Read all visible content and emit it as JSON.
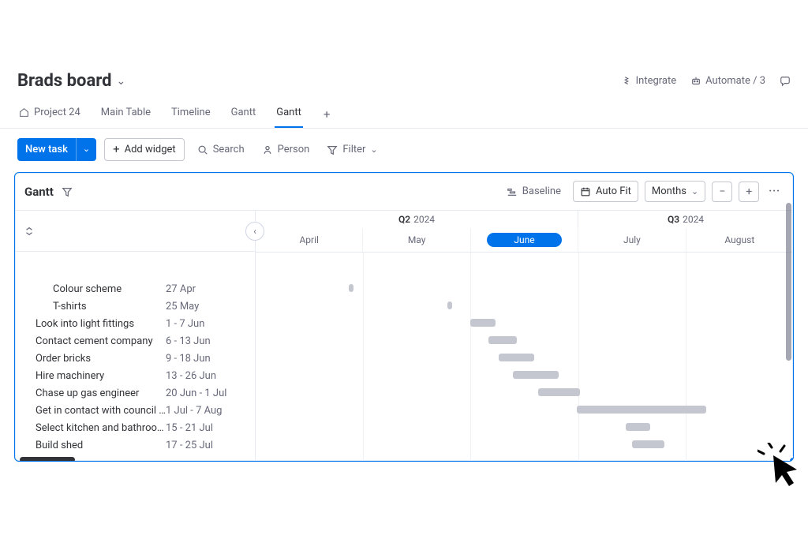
{
  "header": {
    "board_title": "Brads board",
    "integrate_label": "Integrate",
    "automate_label": "Automate / 3"
  },
  "tabs": [
    {
      "label": "Project 24",
      "icon": "home"
    },
    {
      "label": "Main Table"
    },
    {
      "label": "Timeline"
    },
    {
      "label": "Gantt"
    },
    {
      "label": "Gantt",
      "active": true
    }
  ],
  "toolbar": {
    "new_task_label": "New task",
    "add_widget_label": "Add widget",
    "search_label": "Search",
    "person_label": "Person",
    "filter_label": "Filter"
  },
  "widget": {
    "title": "Gantt",
    "baseline_label": "Baseline",
    "auto_fit_label": "Auto Fit",
    "timescale_label": "Months"
  },
  "timeline": {
    "quarters": [
      {
        "q": "Q2",
        "year": "2024"
      },
      {
        "q": "Q3",
        "year": "2024"
      }
    ],
    "months": [
      {
        "label": "April"
      },
      {
        "label": "May"
      },
      {
        "label": "June",
        "current": true
      },
      {
        "label": "July"
      },
      {
        "label": "August"
      }
    ]
  },
  "tasks": [
    {
      "name": "Colour scheme",
      "date": "27 Apr",
      "indent": true,
      "left_pct": 17.3,
      "width_pct": 0.9
    },
    {
      "name": "T-shirts",
      "date": "25 May",
      "indent": true,
      "left_pct": 35.7,
      "width_pct": 0.9
    },
    {
      "name": "Look into light fittings",
      "date": "1 - 7 Jun",
      "left_pct": 40.0,
      "width_pct": 4.6
    },
    {
      "name": "Contact cement company",
      "date": "6 - 13 Jun",
      "left_pct": 43.3,
      "width_pct": 5.3
    },
    {
      "name": "Order bricks",
      "date": "9 - 18 Jun",
      "left_pct": 45.3,
      "width_pct": 6.5
    },
    {
      "name": "Hire machinery",
      "date": "13 - 26 Jun",
      "left_pct": 47.9,
      "width_pct": 8.5
    },
    {
      "name": "Chase up gas engineer",
      "date": "20 Jun - 1 Jul",
      "left_pct": 52.5,
      "width_pct": 7.8
    },
    {
      "name": "Get in contact with council ab…",
      "date": "1 Jul - 7 Aug",
      "left_pct": 59.7,
      "width_pct": 24.2
    },
    {
      "name": "Select kitchen and bathroom",
      "date": "15 - 21 Jul",
      "left_pct": 68.8,
      "width_pct": 4.6
    },
    {
      "name": "Build shed",
      "date": "17 - 25 Jul",
      "left_pct": 70.1,
      "width_pct": 5.9
    }
  ]
}
